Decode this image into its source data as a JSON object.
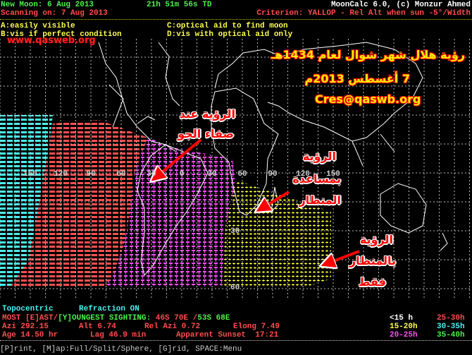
{
  "header": {
    "new_moon": "New Moon: 6 Aug 2013",
    "time": "21h 51m 56s TD",
    "app": "MoonCalc 6.0, (c) Monzur Ahmed",
    "scanning": "Scanning on: 7 Aug 2013",
    "criterion": "Criterion: YALLOP - Rel Alt when sun -5°/Width"
  },
  "legend_codes": {
    "a": "A:easily visible",
    "b": "B:vis if perfect condition",
    "c": "C:optical aid to find moon",
    "d": "D:vis with optical aid only"
  },
  "overlay": {
    "site": "www.qasweb.org",
    "title_line1": "رؤية هلال شهر شوال لعام 1434هـ",
    "title_line2": "7 أغسطس 2013م",
    "email": "Cres@qaswb.org",
    "label_clear_1": "الرؤية عند",
    "label_clear_2": "صفاء الجو",
    "label_aid_1": "الرؤية",
    "label_aid_2": "بمساعدة",
    "label_aid_3": "المنظار",
    "label_only_1": "الرؤية",
    "label_only_2": "بالمنظار",
    "label_only_3": "فقط"
  },
  "map": {
    "lon_labels": [
      "150",
      "120",
      "90",
      "60",
      "30",
      "0",
      "30",
      "60",
      "90",
      "120",
      "150"
    ],
    "lat_labels": [
      "30",
      "60"
    ],
    "colors": {
      "cyan": "#4cf0f0",
      "red": "#ff5050",
      "magenta": "#ff4cff",
      "yellow": "#ffff30",
      "coast": "#ffffff",
      "arrow": "#ff0000"
    }
  },
  "footer": {
    "mode": "Topocentric",
    "refraction": "Refraction ON",
    "most_e": "MOST [E]AST/",
    "most_y": "[Y]OUNGEST SIGHTING:",
    "coords_e": "46S 70E /",
    "coords_y": "53S 68E",
    "azi": "Azi 292.15",
    "alt": "Alt 6.74",
    "rel_azi": "Rel Azi 0.72",
    "elong": "Elong 7.49",
    "age": "Age 14.50 hr",
    "lag": "Lag 46.9 min",
    "sunset": "Apparent Sunset  17:21",
    "age_legend": [
      {
        "label": "<15 h",
        "color": "#ffffff"
      },
      {
        "label": "25-30h",
        "color": "#ff4c4c"
      },
      {
        "label": "15-20h",
        "color": "#ffff4c"
      },
      {
        "label": "30-35h",
        "color": "#4cf0f0"
      },
      {
        "label": "20-25h",
        "color": "#ff4cff"
      },
      {
        "label": "35-40h",
        "color": "#4cf04c"
      }
    ],
    "menu": "[P]rint, [M]ap:Full/Split/Sphere, [G]rid, SPACE:Menu"
  }
}
